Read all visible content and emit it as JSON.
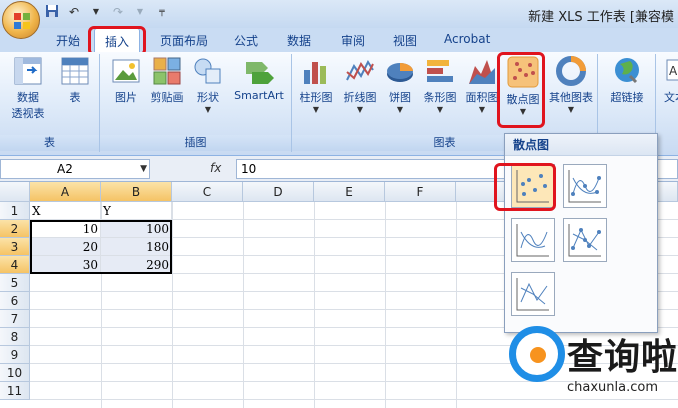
{
  "window": {
    "title": "新建 XLS 工作表 [兼容模"
  },
  "tabs": [
    {
      "label": "开始"
    },
    {
      "label": "插入"
    },
    {
      "label": "页面布局"
    },
    {
      "label": "公式"
    },
    {
      "label": "数据"
    },
    {
      "label": "审阅"
    },
    {
      "label": "视图"
    },
    {
      "label": "Acrobat"
    }
  ],
  "ribbon": {
    "groups": {
      "table": "表",
      "illustrations": "插图",
      "charts": "图表"
    },
    "buttons": {
      "pivot_line1": "数据",
      "pivot_line2": "透视表",
      "table": "表",
      "picture": "图片",
      "clipart": "剪贴画",
      "shapes": "形状",
      "smartart": "SmartArt",
      "column": "柱形图",
      "line": "折线图",
      "pie": "饼图",
      "bar": "条形图",
      "area": "面积图",
      "scatter": "散点图",
      "other": "其他图表",
      "hyperlink": "超链接",
      "text": "文本"
    }
  },
  "formula_bar": {
    "name_box": "A2",
    "fx": "fx",
    "value": "10"
  },
  "sheet": {
    "columns": [
      "A",
      "B",
      "C",
      "D",
      "E",
      "F"
    ],
    "rows": [
      "1",
      "2",
      "3",
      "4",
      "5",
      "6",
      "7",
      "8",
      "9",
      "10",
      "11"
    ],
    "cells": {
      "a1": "X",
      "b1": "Y",
      "a2": "10",
      "b2": "100",
      "a3": "20",
      "b3": "180",
      "a4": "30",
      "b4": "290"
    }
  },
  "gallery": {
    "title": "散点图"
  },
  "watermark": {
    "brand": "查询啦",
    "url": "chaxunla.com"
  },
  "colors": {
    "highlight_red": "#e0141e",
    "ribbon_blue": "#15428b"
  }
}
